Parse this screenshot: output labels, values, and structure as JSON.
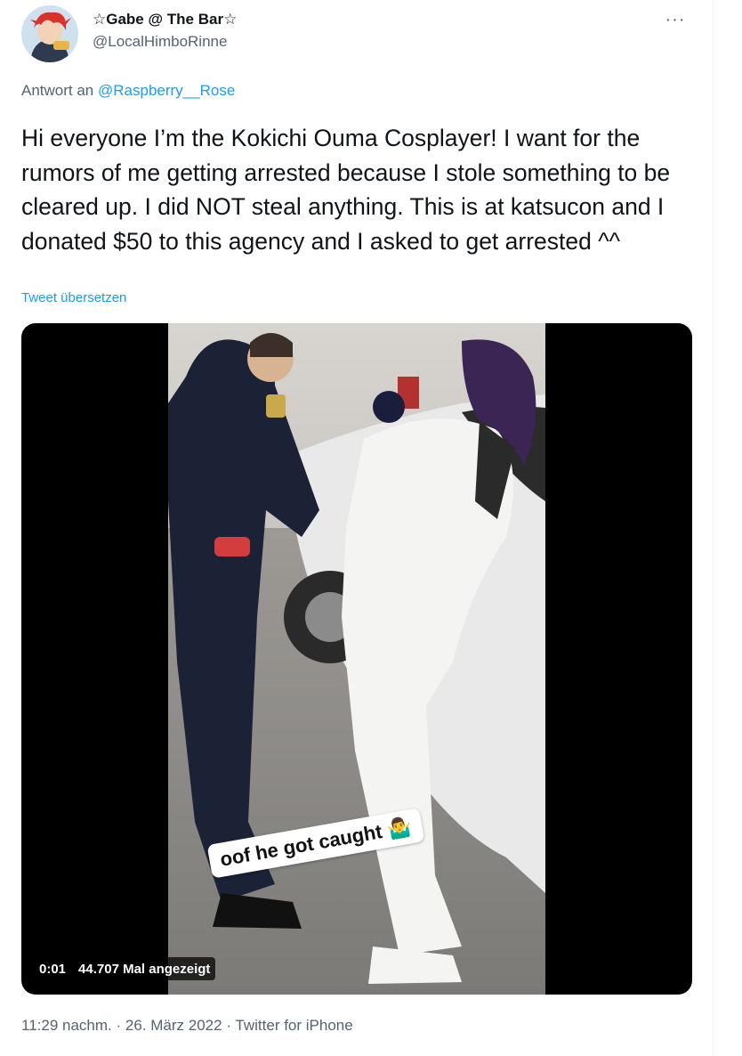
{
  "tweet": {
    "display_name": "☆Gabe @ The Bar☆",
    "handle": "@LocalHimboRinne",
    "more_icon": "···",
    "reply_prefix": "Antwort an",
    "reply_to": "@Raspberry__Rose",
    "text": "Hi everyone I’m the Kokichi Ouma Cosplayer! I want for the rumors of me getting arrested because I stole something to be cleared up. I did NOT steal anything. This is at katsucon and I donated $50 to this agency and I asked to get arrested ^^",
    "translate_label": "Tweet übersetzen",
    "video": {
      "time": "0:01",
      "views": "44.707 Mal angezeigt",
      "sticker_text": "oof he got caught"
    },
    "time": "11:29 nachm.",
    "date": "26. März 2022",
    "source": "Twitter for iPhone",
    "separator": "·"
  },
  "colors": {
    "link": "#1d9bf0",
    "secondary_text": "#536471",
    "primary_text": "#0f1419"
  }
}
